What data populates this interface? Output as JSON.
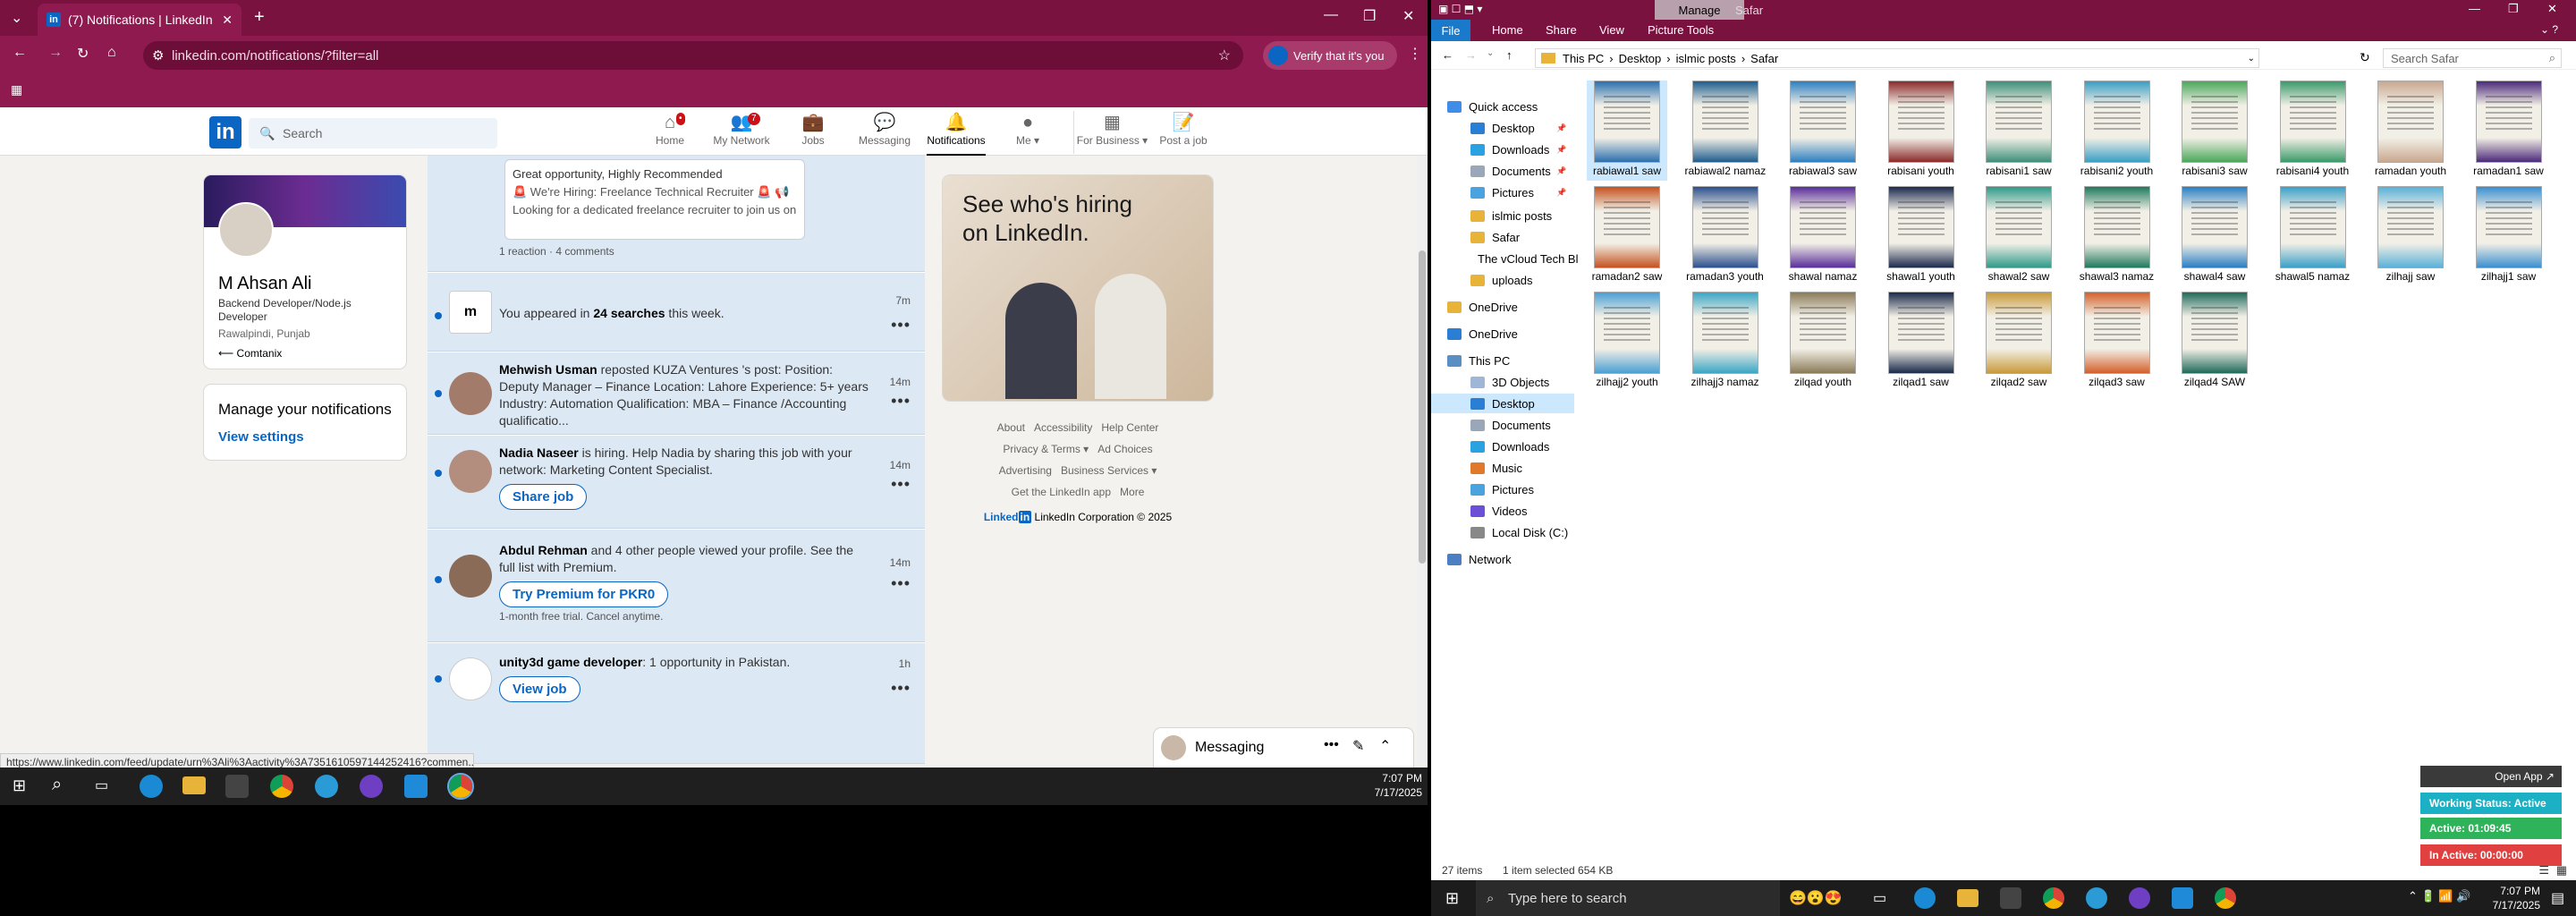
{
  "browser": {
    "tab_title": "(7) Notifications | LinkedIn",
    "url": "linkedin.com/notifications/?filter=all",
    "verify_label": "Verify that it's you",
    "status_url": "https://www.linkedin.com/feed/update/urn%3Ali%3Aactivity%3A7351610597144252416?commen..."
  },
  "linkedin": {
    "search_placeholder": "Search",
    "nav": [
      {
        "label": "Home",
        "badge": ""
      },
      {
        "label": "My Network",
        "badge": "7"
      },
      {
        "label": "Jobs",
        "badge": ""
      },
      {
        "label": "Messaging",
        "badge": ""
      },
      {
        "label": "Notifications",
        "badge": ""
      },
      {
        "label": "Me ▾",
        "badge": ""
      },
      {
        "label": "For Business ▾",
        "badge": ""
      },
      {
        "label": "Post a job",
        "badge": ""
      }
    ],
    "profile": {
      "name": "M Ahsan Ali",
      "headline": "Backend Developer/Node.js Developer",
      "location": "Rawalpindi, Punjab",
      "company": "Comtanix"
    },
    "manage": {
      "title": "Manage your notifications",
      "link": "View settings"
    },
    "top_card": {
      "text1": "Great opportunity, Highly Recommended",
      "text2": "🚨 We're Hiring: Freelance Technical Recruiter 🚨 📢 Looking for a dedicated freelance recruiter to join us on a freelance basi...",
      "reactions": "1 reaction · 4 comments"
    },
    "notifications": [
      {
        "text_pre": "You appeared in ",
        "bold": "24 searches",
        "text_post": " this week.",
        "time": "7m",
        "button": "",
        "sub": ""
      },
      {
        "text_pre": "",
        "bold": "Mehwish Usman",
        "text_post": " reposted KUZA Ventures 's post: Position: Deputy Manager – Finance Location: Lahore Experience: 5+ years Industry: Automation Qualification: MBA – Finance /Accounting qualificatio...",
        "time": "14m",
        "button": "",
        "sub": ""
      },
      {
        "text_pre": "",
        "bold": "Nadia Naseer",
        "text_post": " is hiring. Help Nadia by sharing this job with your network: Marketing Content Specialist.",
        "time": "14m",
        "button": "Share job",
        "sub": ""
      },
      {
        "text_pre": "",
        "bold": "Abdul Rehman",
        "text_post": " and 4 other people viewed your profile. See the full list with Premium.",
        "time": "14m",
        "button": "Try Premium for PKR0",
        "sub": "1-month free trial. Cancel anytime."
      },
      {
        "text_pre": "",
        "bold": "unity3d game developer",
        "text_post": ": 1 opportunity in Pakistan.",
        "time": "1h",
        "button": "View job",
        "sub": ""
      }
    ],
    "ad": {
      "line1": "See who's hiring",
      "line2": "on LinkedIn."
    },
    "footer": {
      "links": [
        "About",
        "Accessibility",
        "Help Center",
        "Privacy & Terms ▾",
        "Ad Choices",
        "Advertising",
        "Business Services ▾",
        "Get the LinkedIn app",
        "More"
      ],
      "copyright": "LinkedIn Corporation © 2025"
    },
    "messaging_label": "Messaging"
  },
  "taskbar_left": {
    "time": "7:07 PM",
    "date": "7/17/2025"
  },
  "explorer": {
    "title": "Safar",
    "manage_label": "Manage",
    "ribbon_tabs": [
      "File",
      "Home",
      "Share",
      "View",
      "Picture Tools"
    ],
    "path": [
      "This PC",
      "Desktop",
      "islmic posts",
      "Safar"
    ],
    "search_placeholder": "Search Safar",
    "nav_items": [
      {
        "label": "Quick access",
        "pin": ""
      },
      {
        "label": "Desktop",
        "pin": "📌"
      },
      {
        "label": "Downloads",
        "pin": "📌"
      },
      {
        "label": "Documents",
        "pin": "📌"
      },
      {
        "label": "Pictures",
        "pin": "📌"
      },
      {
        "label": "islmic posts",
        "pin": ""
      },
      {
        "label": "Safar",
        "pin": ""
      },
      {
        "label": "The vCloud Tech Bl",
        "pin": ""
      },
      {
        "label": "uploads",
        "pin": ""
      },
      {
        "label": "OneDrive",
        "pin": ""
      },
      {
        "label": "OneDrive",
        "pin": ""
      },
      {
        "label": "This PC",
        "pin": ""
      },
      {
        "label": "3D Objects",
        "pin": ""
      },
      {
        "label": "Desktop",
        "pin": ""
      },
      {
        "label": "Documents",
        "pin": ""
      },
      {
        "label": "Downloads",
        "pin": ""
      },
      {
        "label": "Music",
        "pin": ""
      },
      {
        "label": "Pictures",
        "pin": ""
      },
      {
        "label": "Videos",
        "pin": ""
      },
      {
        "label": "Local Disk (C:)",
        "pin": ""
      },
      {
        "label": "Network",
        "pin": ""
      }
    ],
    "files": [
      "rabiawal1 saw",
      "rabiawal2 namaz",
      "rabiawal3 saw",
      "rabisani youth",
      "rabisani1 saw",
      "rabisani2 youth",
      "rabisani3 saw",
      "rabisani4 youth",
      "ramadan youth",
      "ramadan1 saw",
      "ramadan2 saw",
      "ramadan3 youth",
      "shawal namaz",
      "shawal1 youth",
      "shawal2 saw",
      "shawal3 namaz",
      "shawal4 saw",
      "shawal5 namaz",
      "zilhajj saw",
      "zilhajj1 saw",
      "zilhajj2 youth",
      "zilhajj3 namaz",
      "zilqad youth",
      "zilqad1 saw",
      "zilqad2 saw",
      "zilqad3 saw",
      "zilqad4 SAW"
    ],
    "status_items": "27 items",
    "status_selected": "1 item selected  654 KB"
  },
  "taskbar_right": {
    "search_placeholder": "Type here to search",
    "time": "7:07 PM",
    "date": "7/17/2025"
  },
  "widget": {
    "open_app": "Open App ↗",
    "working": "Working Status: Active",
    "active": "Active: 01:09:45",
    "inactive": "In Active: 00:00:00"
  },
  "colors": {
    "browser_frame": "#7a1240",
    "linkedin_blue": "#0a66c2",
    "unread_bg": "#dce8f4"
  }
}
